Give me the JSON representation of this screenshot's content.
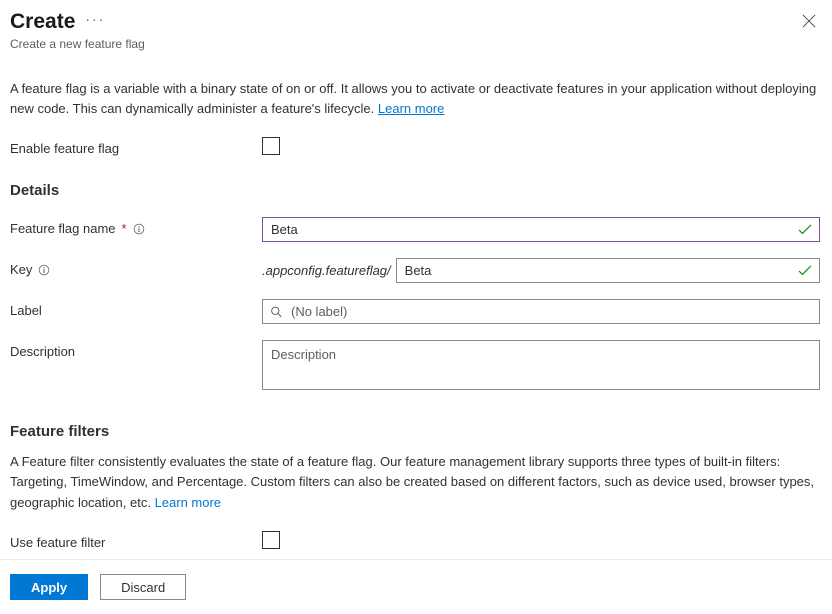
{
  "header": {
    "title": "Create",
    "subtitle": "Create a new feature flag"
  },
  "intro_text": "A feature flag is a variable with a binary state of on or off. It allows you to activate or deactivate features in your application without deploying new code. This can dynamically administer a feature's lifecycle.",
  "learn_more": "Learn more",
  "enable_label": "Enable feature flag",
  "details_heading": "Details",
  "fields": {
    "name": {
      "label": "Feature flag name",
      "value": "Beta"
    },
    "key": {
      "label": "Key",
      "prefix": ".appconfig.featureflag/",
      "value": "Beta"
    },
    "label_field": {
      "label": "Label",
      "placeholder": "(No label)"
    },
    "description": {
      "label": "Description",
      "placeholder": "Description"
    }
  },
  "filters": {
    "heading": "Feature filters",
    "description": "A Feature filter consistently evaluates the state of a feature flag. Our feature management library supports three types of built-in filters: Targeting, TimeWindow, and Percentage. Custom filters can also be created based on different factors, such as device used, browser types, geographic location, etc.",
    "learn_more": "Learn more",
    "use_filter_label": "Use feature filter"
  },
  "footer": {
    "apply": "Apply",
    "discard": "Discard"
  }
}
